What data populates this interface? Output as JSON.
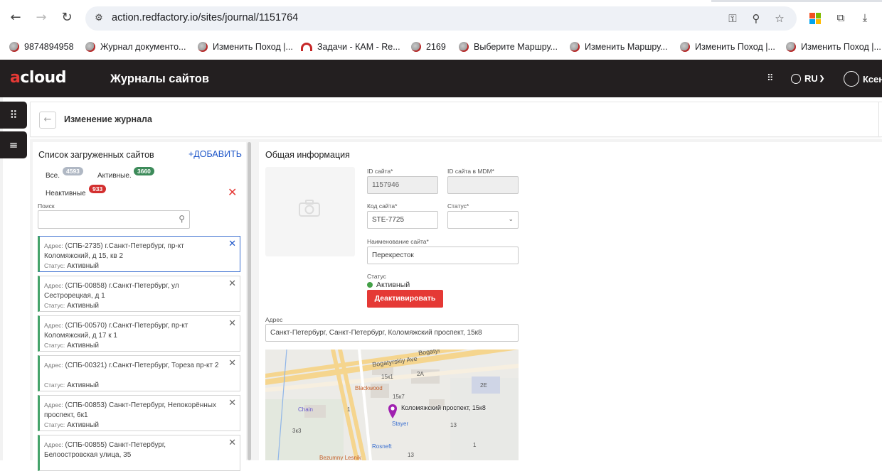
{
  "browser": {
    "url": "action.redfactory.io/sites/journal/1151764",
    "bookmarks": [
      {
        "label": "9874894958",
        "icon": "favicon"
      },
      {
        "label": "Журнал документо...",
        "icon": "favicon"
      },
      {
        "label": "Изменить Поход |...",
        "icon": "favicon"
      },
      {
        "label": "Задачи - КАМ - Re...",
        "icon": "rc-icon"
      },
      {
        "label": "2169",
        "icon": "favicon"
      },
      {
        "label": "Выберите Маршру...",
        "icon": "favicon"
      },
      {
        "label": "Изменить Маршру...",
        "icon": "favicon"
      },
      {
        "label": "Изменить Поход |...",
        "icon": "favicon"
      },
      {
        "label": "Изменить Поход |...",
        "icon": "favicon"
      }
    ]
  },
  "app": {
    "logo_prefix": "a",
    "logo_rest": "cloud",
    "title": "Журналы сайтов",
    "language": "RU",
    "user": "Ксен",
    "brand_color": "#e53935",
    "header_color": "#231f20"
  },
  "breadcrumb": {
    "title": "Изменение журнала"
  },
  "list": {
    "title": "Список загруженных сайтов",
    "add_label": "+ДОБАВИТЬ",
    "filters": {
      "all_label": "Все.",
      "all_count": "4593",
      "active_label": "Активные.",
      "active_count": "3660",
      "inactive_label": "Неактивные",
      "inactive_count": "933"
    },
    "search_label": "Поиск",
    "search_value": "",
    "address_label": "Адрес:",
    "status_label": "Статус:",
    "items": [
      {
        "line1": "(СПБ-2735) г.Санкт-Петербург, пр-кт",
        "line2": "Коломяжский, д 15, кв 2",
        "status": "Активный"
      },
      {
        "line1": "(СПБ-00858) г.Санкт-Петербург, ул",
        "line2": "Сестрорецкая, д 1",
        "status": "Активный"
      },
      {
        "line1": "(СПБ-00570) г.Санкт-Петербург, пр-кт",
        "line2": "Коломяжский, д 17 к 1",
        "status": "Активный"
      },
      {
        "line1": "(СПБ-00321) г.Санкт-Петербург, Тореза пр-кт 2",
        "line2": "",
        "status": "Активный"
      },
      {
        "line1": "(СПБ-00853) Санкт-Петербург, Непокорённых",
        "line2": "проспект, 6к1",
        "status": "Активный"
      },
      {
        "line1": "(СПБ-00855) Санкт-Петербург,",
        "line2": "Белоостровская улица, 35",
        "status": ""
      }
    ]
  },
  "form": {
    "section_title": "Общая информация",
    "site_id_label": "ID сайта*",
    "site_id_value": "1157946",
    "mdm_id_label": "ID сайта в MDM*",
    "mdm_id_value": "",
    "site_code_label": "Код сайта*",
    "site_code_value": "STE-7725",
    "status_select_label": "Статус*",
    "status_select_value": "",
    "site_name_label": "Наименование сайта*",
    "site_name_value": "Перекресток",
    "status_label": "Статус",
    "status_value": "Активный",
    "deactivate_label": "Деактивировать",
    "address_label": "Адрес",
    "address_value": "Санкт-Петербург, Санкт-Петербург, Коломяжский проспект, 15к8"
  },
  "map": {
    "pin_label": "Коломяжский проспект, 15к8",
    "labels": [
      "Bogatyrskiy Ave",
      "Bogatyr",
      "Blackwood",
      "Chain",
      "Stayer",
      "Rosneft",
      "Bezumny Lesnik",
      "15к1",
      "15к7",
      "2А",
      "2Е",
      "13",
      "13",
      "3к3",
      "1",
      "1"
    ]
  }
}
